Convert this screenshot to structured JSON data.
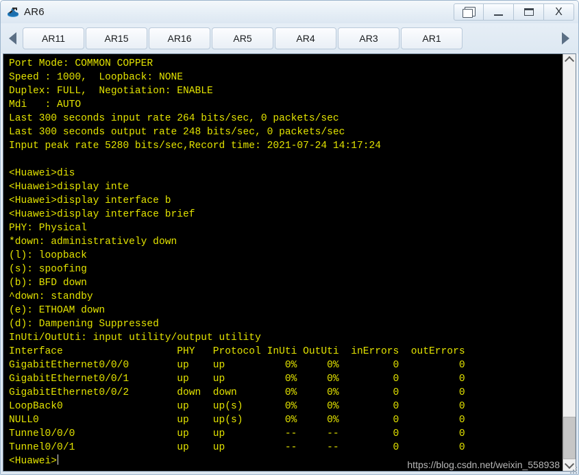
{
  "window": {
    "title": "AR6",
    "icon": "router-icon",
    "buttons": [
      {
        "name": "restore-button",
        "glyph": "restore-icon",
        "label": ""
      },
      {
        "name": "minimize-button",
        "glyph": "minimize-icon",
        "label": ""
      },
      {
        "name": "maximize-button",
        "glyph": "maximize-icon",
        "label": ""
      },
      {
        "name": "close-button",
        "glyph": "close-icon",
        "label": "X"
      }
    ]
  },
  "tabbar": {
    "scroll_left_icon": "arrow-left-icon",
    "scroll_right_icon": "arrow-right-icon",
    "tabs": [
      {
        "label": "AR11"
      },
      {
        "label": "AR15"
      },
      {
        "label": "AR16"
      },
      {
        "label": "AR5"
      },
      {
        "label": "AR4"
      },
      {
        "label": "AR3"
      },
      {
        "label": "AR1"
      }
    ]
  },
  "terminal": {
    "foreground_color": "#e3e300",
    "background_color": "#000000",
    "lines": [
      "Port Mode: COMMON COPPER",
      "Speed : 1000,  Loopback: NONE",
      "Duplex: FULL,  Negotiation: ENABLE",
      "Mdi   : AUTO",
      "Last 300 seconds input rate 264 bits/sec, 0 packets/sec",
      "Last 300 seconds output rate 248 bits/sec, 0 packets/sec",
      "Input peak rate 5280 bits/sec,Record time: 2021-07-24 14:17:24",
      "",
      "<Huawei>dis",
      "<Huawei>display inte",
      "<Huawei>display interface b",
      "<Huawei>display interface brief",
      "PHY: Physical",
      "*down: administratively down",
      "(l): loopback",
      "(s): spoofing",
      "(b): BFD down",
      "^down: standby",
      "(e): ETHOAM down",
      "(d): Dampening Suppressed",
      "InUti/OutUti: input utility/output utility",
      "Interface                   PHY   Protocol InUti OutUti  inErrors  outErrors",
      "GigabitEthernet0/0/0        up    up          0%     0%         0          0",
      "GigabitEthernet0/0/1        up    up          0%     0%         0          0",
      "GigabitEthernet0/0/2        down  down        0%     0%         0          0",
      "LoopBack0                   up    up(s)       0%     0%         0          0",
      "NULL0                       up    up(s)       0%     0%         0          0",
      "Tunnel0/0/0                 up    up          --     --         0          0",
      "Tunnel0/0/1                 up    up          --     --         0          0"
    ],
    "prompt": "<Huawei>",
    "interface_table": {
      "columns": [
        "Interface",
        "PHY",
        "Protocol",
        "InUti",
        "OutUti",
        "inErrors",
        "outErrors"
      ],
      "rows": [
        [
          "GigabitEthernet0/0/0",
          "up",
          "up",
          "0%",
          "0%",
          "0",
          "0"
        ],
        [
          "GigabitEthernet0/0/1",
          "up",
          "up",
          "0%",
          "0%",
          "0",
          "0"
        ],
        [
          "GigabitEthernet0/0/2",
          "down",
          "down",
          "0%",
          "0%",
          "0",
          "0"
        ],
        [
          "LoopBack0",
          "up",
          "up(s)",
          "0%",
          "0%",
          "0",
          "0"
        ],
        [
          "NULL0",
          "up",
          "up(s)",
          "0%",
          "0%",
          "0",
          "0"
        ],
        [
          "Tunnel0/0/0",
          "up",
          "up",
          "--",
          "--",
          "0",
          "0"
        ],
        [
          "Tunnel0/0/1",
          "up",
          "up",
          "--",
          "--",
          "0",
          "0"
        ]
      ]
    },
    "watermark": "https://blog.csdn.net/weixin_558938"
  },
  "scrollbar": {
    "up_icon": "chevron-up-icon",
    "down_icon": "chevron-down-icon"
  }
}
